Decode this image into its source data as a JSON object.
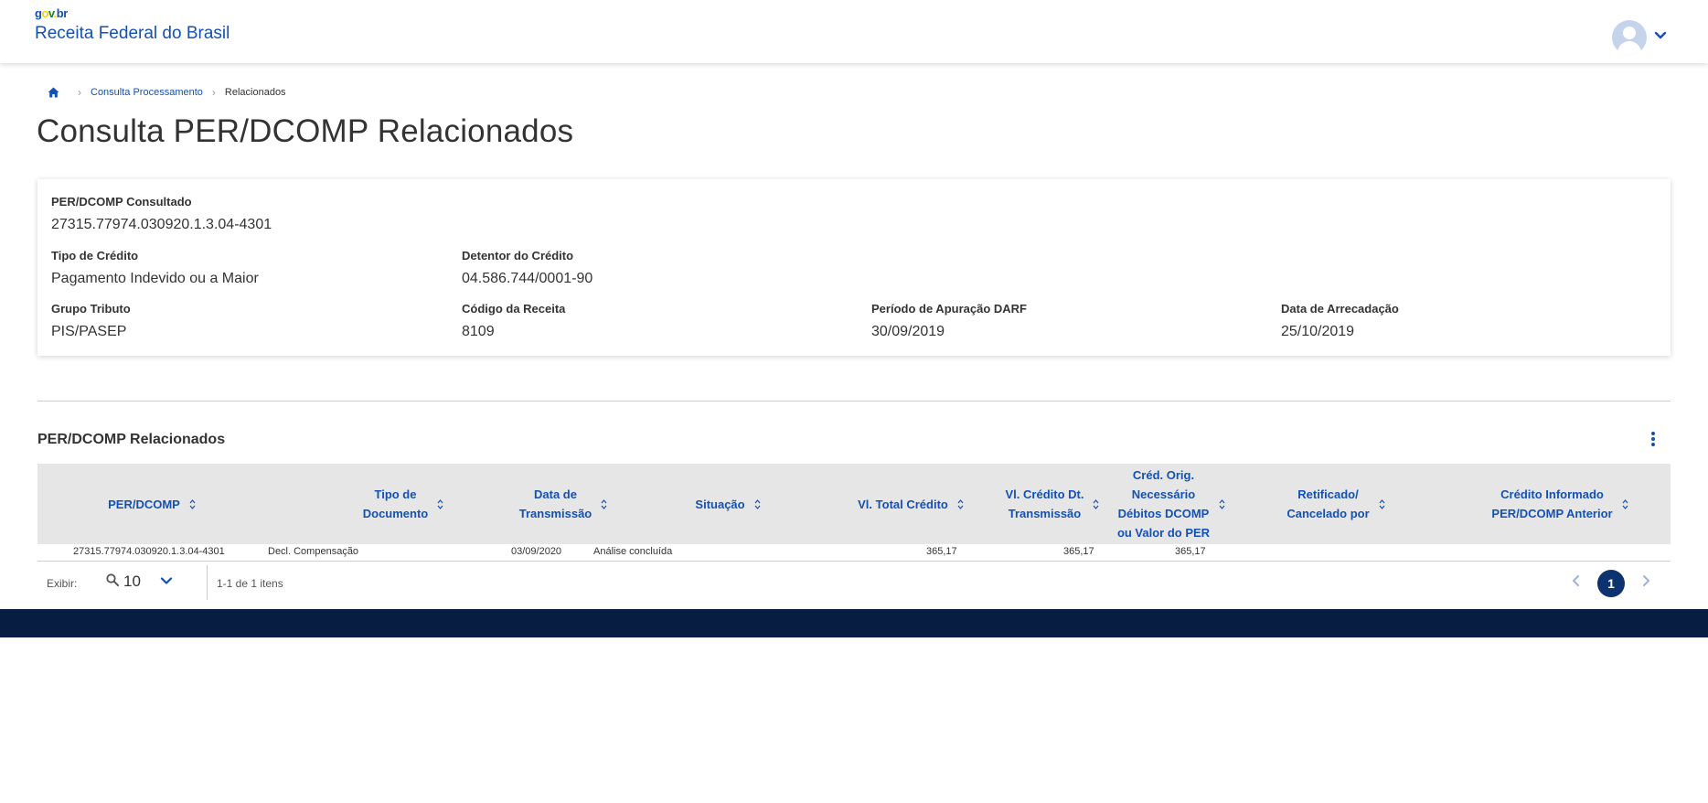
{
  "header": {
    "logo_parts": [
      "g",
      "o",
      "v",
      ".",
      "b",
      "r"
    ],
    "app_title": "Receita Federal do Brasil"
  },
  "breadcrumb": {
    "items": [
      "Consulta Processamento",
      "Relacionados"
    ]
  },
  "page_title": "Consulta PER/DCOMP Relacionados",
  "details": {
    "per_dcomp_consultado": {
      "label": "PER/DCOMP Consultado",
      "value": "27315.77974.030920.1.3.04-4301"
    },
    "tipo_credito": {
      "label": "Tipo de Crédito",
      "value": "Pagamento Indevido ou a Maior"
    },
    "detentor_credito": {
      "label": "Detentor do Crédito",
      "value": "04.586.744/0001-90"
    },
    "grupo_tributo": {
      "label": "Grupo Tributo",
      "value": "PIS/PASEP"
    },
    "codigo_receita": {
      "label": "Código da Receita",
      "value": "8109"
    },
    "periodo_apuracao": {
      "label": "Período de Apuração DARF",
      "value": "30/09/2019"
    },
    "data_arrecadacao": {
      "label": "Data de Arrecadação",
      "value": "25/10/2019"
    }
  },
  "table": {
    "title": "PER/DCOMP Relacionados",
    "columns": [
      "PER/DCOMP",
      "Tipo de\nDocumento",
      "Data de\nTransmissão",
      "Situação",
      "Vl. Total Crédito",
      "Vl. Crédito Dt.\nTransmissão",
      "Créd. Orig.\nNecessário\nDébitos DCOMP\nou Valor do PER",
      "Retificado/\nCancelado por",
      "Crédito Informado\nPER/DCOMP Anterior"
    ],
    "rows": [
      [
        "27315.77974.030920.1.3.04-4301",
        "Decl. Compensação",
        "03/09/2020",
        "Análise concluída",
        "365,17",
        "365,17",
        "365,17",
        "",
        ""
      ]
    ]
  },
  "pagination": {
    "show_label": "Exibir:",
    "per_page": "10",
    "items_info": "1-1 de 1 itens",
    "current_page": "1"
  },
  "colors": {
    "primary": "#1351b4",
    "header_table": "#e6e6e6",
    "footer": "#071d41",
    "active_page": "#0c326f"
  }
}
